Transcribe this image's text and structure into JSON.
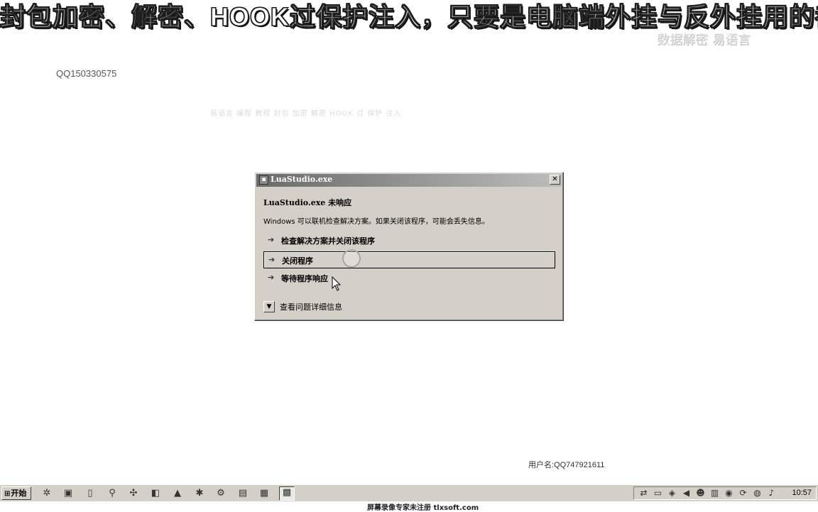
{
  "banner": {
    "prefix": "封包加密",
    "mid1": "、解密、",
    "hook": "HOOK",
    "suffix": "过保护注入，只要是电脑端外挂与反外挂用的都",
    "sub": "数据解密  易语言"
  },
  "desktop": {
    "qq_label": "QQ150330575",
    "faint_text": "易语言 编程 教程 封包 加密 解密 HOOK 过 保护 注入",
    "username": "用户名:QQ747921611"
  },
  "dialog": {
    "title": "LuaStudio.exe",
    "close_glyph": "✕",
    "heading": "LuaStudio.exe 未响应",
    "description": "Windows 可以联机检查解决方案。如果关闭该程序，可能会丢失信息。",
    "options": [
      {
        "label": "检查解决方案并关闭该程序"
      },
      {
        "label": "关闭程序"
      },
      {
        "label": "等待程序响应"
      }
    ],
    "details_label": "查看问题详细信息"
  },
  "taskbar": {
    "start_label": "开始",
    "clock": "10:57",
    "icons": [
      "gear-icon",
      "folder-icon",
      "document-icon",
      "magnifier-icon",
      "tool-icon",
      "camera-icon",
      "chart-icon",
      "bug-icon",
      "settings-icon",
      "window-icon",
      "notepad-icon",
      "app-icon"
    ],
    "tray_icons": [
      "network-icon",
      "monitor-icon",
      "shield-icon",
      "volume-icon",
      "user-icon",
      "input-icon",
      "security-icon",
      "update-icon",
      "globe-icon",
      "speaker-icon"
    ]
  },
  "footer": {
    "watermark": "屏幕录像专家未注册 tlxsoft.com"
  }
}
